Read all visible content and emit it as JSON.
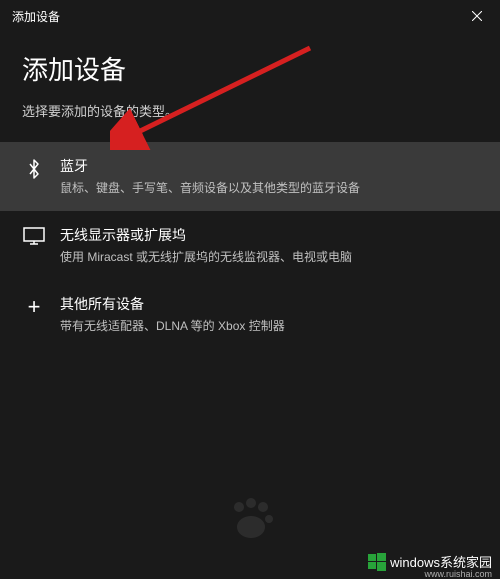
{
  "titlebar": {
    "title": "添加设备"
  },
  "header": {
    "title": "添加设备",
    "subtitle": "选择要添加的设备的类型。"
  },
  "options": [
    {
      "title": "蓝牙",
      "desc": "鼠标、键盘、手写笔、音频设备以及其他类型的蓝牙设备"
    },
    {
      "title": "无线显示器或扩展坞",
      "desc": "使用 Miracast 或无线扩展坞的无线监视器、电视或电脑"
    },
    {
      "title": "其他所有设备",
      "desc": "带有无线适配器、DLNA 等的 Xbox 控制器"
    }
  ],
  "watermark": {
    "text": "windows系统家园",
    "sub": "www.ruishai.com"
  }
}
